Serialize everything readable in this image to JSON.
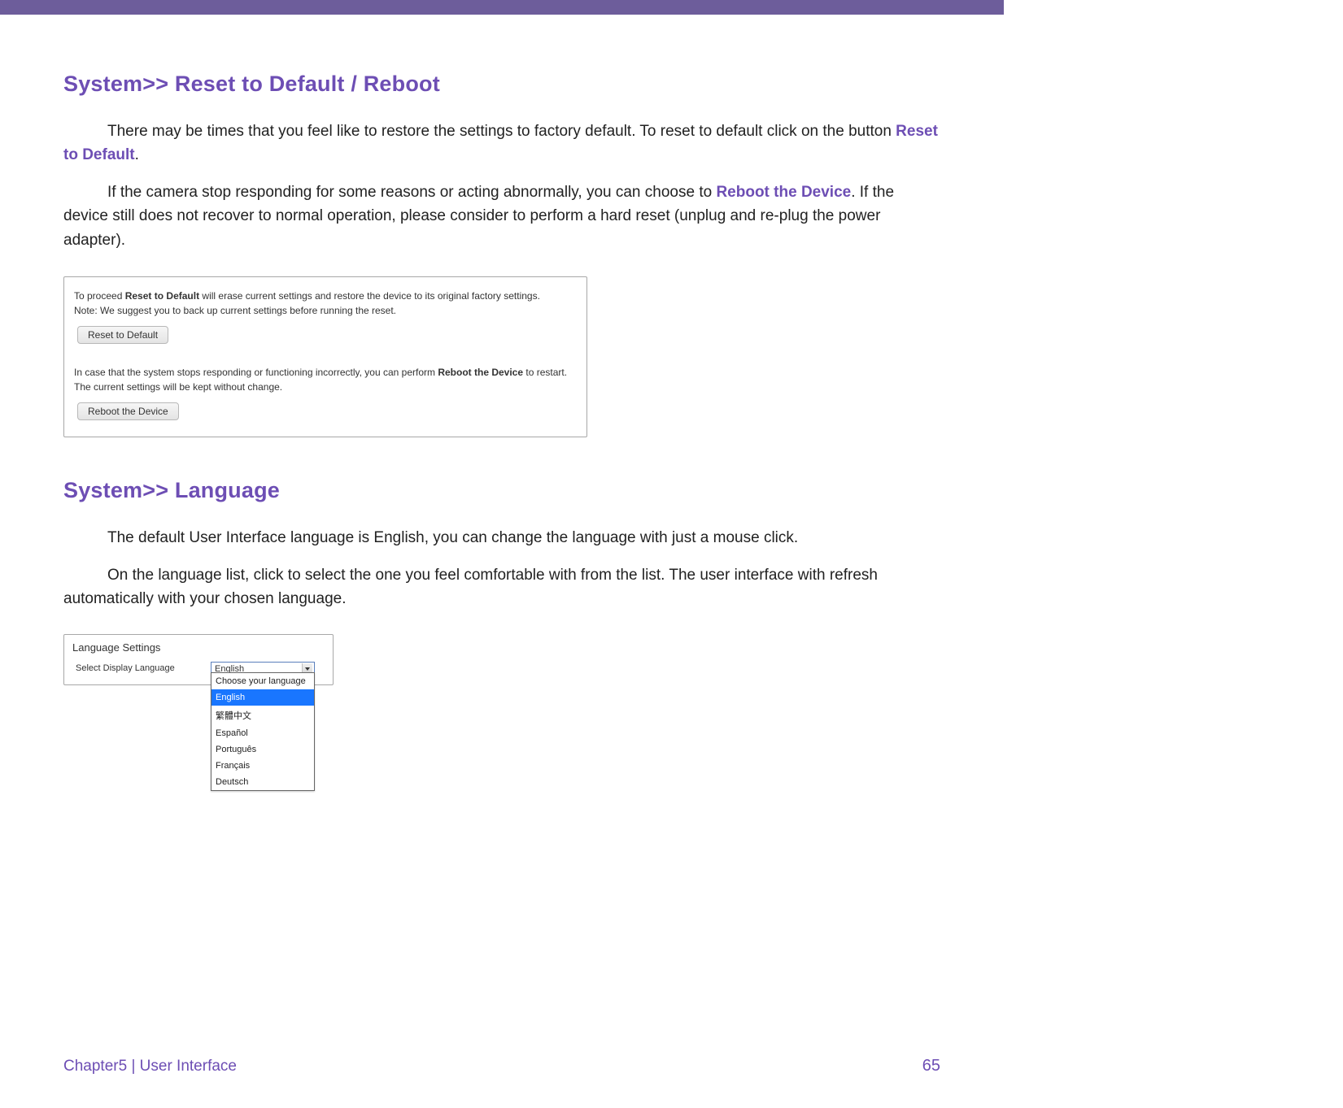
{
  "headings": {
    "reset": "System>> Reset to Default / Reboot",
    "language": "System>> Language"
  },
  "paragraphs": {
    "reset_p1_a": "There may be times that you feel like to restore the settings to factory default. To reset to default click on the button ",
    "reset_p1_action": "Reset to Default",
    "reset_p1_b": ".",
    "reset_p2_a": "If the camera stop responding for some reasons or acting abnormally, you can choose to ",
    "reset_p2_action": "Reboot the Device",
    "reset_p2_b": ". If the device still does not recover to normal operation, please consider to perform a hard reset (unplug and re-plug the power adapter).",
    "lang_p1": "The default User Interface language is English, you can change the language with just a mouse click.",
    "lang_p2": "On the language list, click to select the one you feel comfortable with from the list. The user interface with refresh automatically with your chosen language."
  },
  "reset_panel": {
    "line1_a": "To proceed ",
    "line1_b": "Reset to Default",
    "line1_c": " will erase current settings and restore the device to its original factory settings.",
    "note": "Note: We suggest you to back up current settings before running the reset.",
    "btn_reset": "Reset to Default",
    "line2_a": "In case that the system stops responding or functioning incorrectly, you can perform ",
    "line2_b": "Reboot the Device",
    "line2_c": " to restart. The current settings will be kept without change.",
    "btn_reboot": "Reboot the Device"
  },
  "lang_panel": {
    "title": "Language Settings",
    "label": "Select Display Language",
    "selected": "English",
    "options": [
      "Choose your language",
      "English",
      "繁體中文",
      "Español",
      "Português",
      "Français",
      "Deutsch"
    ],
    "selectedIndex": 1
  },
  "footer": {
    "left": "Chapter5  |  User Interface",
    "page": "65"
  }
}
